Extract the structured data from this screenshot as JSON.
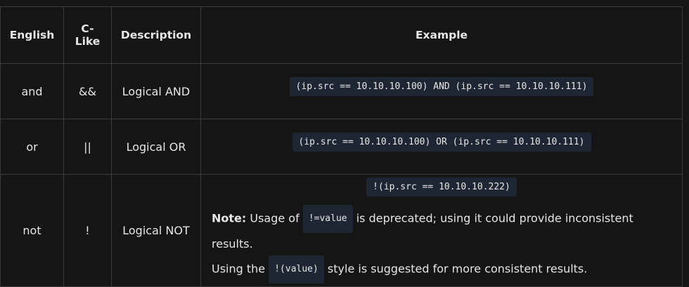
{
  "headers": {
    "english": "English",
    "clike_line1": "C-",
    "clike_line2": "Like",
    "description": "Description",
    "example": "Example"
  },
  "rows": [
    {
      "english": "and",
      "clike": "&&",
      "description": "Logical AND",
      "example": "(ip.src == 10.10.10.100) AND (ip.src == 10.10.10.111)"
    },
    {
      "english": "or",
      "clike": "||",
      "description": "Logical OR",
      "example": "(ip.src == 10.10.10.100) OR (ip.src == 10.10.10.111)"
    },
    {
      "english": "not",
      "clike": "!",
      "description": "Logical NOT",
      "example": "!(ip.src == 10.10.10.222)"
    }
  ],
  "note": {
    "label": "Note:",
    "text1": " Usage of ",
    "code1": "!=value",
    "text2": " is deprecated; using it could provide inconsistent results.",
    "text3": "Using the ",
    "code2": "!(value)",
    "text4": " style is suggested for more consistent results."
  }
}
